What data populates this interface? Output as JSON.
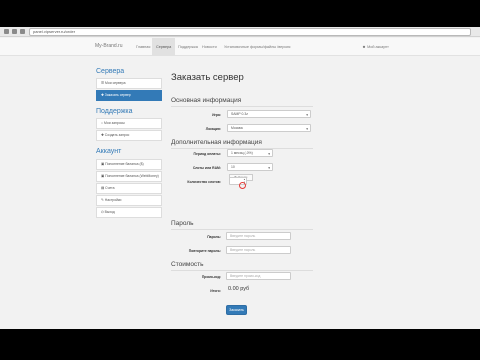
{
  "browser": {
    "url": "panel.vipserver.ru/order"
  },
  "nav": {
    "brand": "My-Brand.ru",
    "links": [
      "Главная",
      "Сервера",
      "Поддержка",
      "Новости",
      "Установочные формы/файлы /версия"
    ],
    "active_index": 1,
    "user": "Мой аккаунт"
  },
  "sidebar": {
    "servers_heading": "Сервера",
    "servers_items": [
      "Мои сервера",
      "Заказать сервер"
    ],
    "support_heading": "Поддержка",
    "support_items": [
      "Мои запросы",
      "Создать запрос"
    ],
    "account_heading": "Аккаунт",
    "account_items": [
      "Пополнение баланса ($)",
      "Пополнение баланса (WebMoney)",
      "Счета",
      "Настройки",
      "Выход"
    ]
  },
  "main": {
    "title": "Заказать сервер",
    "basic_section": "Основная информация",
    "game_label": "Игра:",
    "game_value": "SAMP 0.3z",
    "location_label": "Локация:",
    "location_value": "Москва",
    "extra_section": "Дополнительная информация",
    "period_label": "Период оплаты:",
    "period_value": "1 месяц (-0%)",
    "slots_label": "Слоты или RAM:",
    "slots_value": "10",
    "count_label": "Количество слотов:",
    "count_tooltip": "Выберите",
    "password_section": "Пароль",
    "password_label": "Пароль:",
    "password_placeholder": "Введите пароль",
    "password_repeat_label": "Повторите пароль:",
    "password_repeat_placeholder": "Введите пароль",
    "cost_section": "Стоимость",
    "promo_label": "Промо-код:",
    "promo_placeholder": "Введите промо-код",
    "total_label": "Итого:",
    "total_value": "0.00 руб",
    "order_button": "Заказать"
  }
}
